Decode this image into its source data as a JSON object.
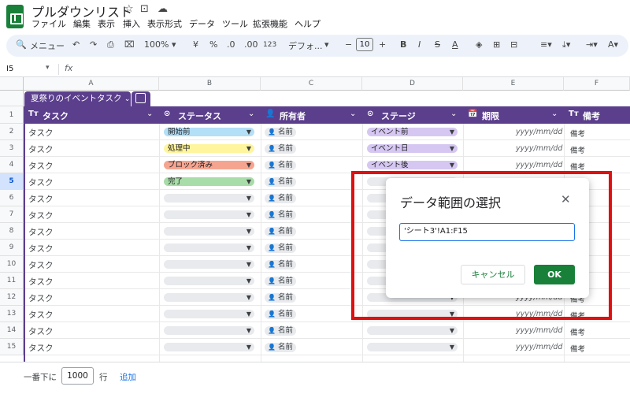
{
  "header": {
    "title": "プルダウンリスト",
    "menus": [
      "ファイル",
      "編集",
      "表示",
      "挿入",
      "表示形式",
      "データ",
      "ツール",
      "拡張機能",
      "ヘルプ"
    ]
  },
  "toolbar": {
    "search": "メニュー",
    "zoom": "100%",
    "currency": "¥",
    "percent": "%",
    "dec_less": ".0",
    "dec_more": ".00",
    "number_fmt": "123",
    "font": "デフォ...",
    "font_size": "10",
    "bold": "B",
    "italic": "I",
    "strike": "S",
    "text_color": "A"
  },
  "formula_bar": {
    "cell_ref": "I5",
    "fx": "fx"
  },
  "columns": [
    "A",
    "B",
    "C",
    "D",
    "E",
    "F"
  ],
  "table": {
    "name": "夏祭りのイベントタスク",
    "headers": [
      "タスク",
      "ステータス",
      "所有者",
      "ステージ",
      "期限",
      "備考"
    ],
    "header_icons": [
      "Tт",
      "⊙",
      "👤",
      "⊙",
      "📅",
      "Tт"
    ]
  },
  "rows": [
    {
      "num": "1"
    },
    {
      "num": "2",
      "task": "タスク",
      "status": "開始前",
      "status_color": "#b3dff7",
      "owner": "名前",
      "stage": "イベント前",
      "stage_color": "#d5c7f1",
      "date": "yyyy/mm/dd",
      "note": "備考"
    },
    {
      "num": "3",
      "task": "タスク",
      "status": "処理中",
      "status_color": "#fff59d",
      "owner": "名前",
      "stage": "イベント日",
      "stage_color": "#d5c7f1",
      "date": "yyyy/mm/dd",
      "note": "備考"
    },
    {
      "num": "4",
      "task": "タスク",
      "status": "ブロック済み",
      "status_color": "#f5a48f",
      "owner": "名前",
      "stage": "イベント後",
      "stage_color": "#d5c7f1",
      "date": "yyyy/mm/dd",
      "note": "備考"
    },
    {
      "num": "5",
      "task": "タスク",
      "status": "完了",
      "status_color": "#a8dca8",
      "owner": "名前",
      "stage": "",
      "stage_color": "#e8eaed",
      "date": "",
      "note": ""
    },
    {
      "num": "6",
      "task": "タスク",
      "status": "",
      "status_color": "#e8eaed",
      "owner": "名前",
      "stage": "",
      "stage_color": "#e8eaed",
      "date": "",
      "note": ""
    },
    {
      "num": "7",
      "task": "タスク",
      "status": "",
      "status_color": "#e8eaed",
      "owner": "名前",
      "stage": "",
      "stage_color": "#e8eaed",
      "date": "",
      "note": ""
    },
    {
      "num": "8",
      "task": "タスク",
      "status": "",
      "status_color": "#e8eaed",
      "owner": "名前",
      "stage": "",
      "stage_color": "#e8eaed",
      "date": "",
      "note": ""
    },
    {
      "num": "9",
      "task": "タスク",
      "status": "",
      "status_color": "#e8eaed",
      "owner": "名前",
      "stage": "",
      "stage_color": "#e8eaed",
      "date": "",
      "note": ""
    },
    {
      "num": "10",
      "task": "タスク",
      "status": "",
      "status_color": "#e8eaed",
      "owner": "名前",
      "stage": "",
      "stage_color": "#e8eaed",
      "date": "",
      "note": ""
    },
    {
      "num": "11",
      "task": "タスク",
      "status": "",
      "status_color": "#e8eaed",
      "owner": "名前",
      "stage": "",
      "stage_color": "#e8eaed",
      "date": "",
      "note": ""
    },
    {
      "num": "12",
      "task": "タスク",
      "status": "",
      "status_color": "#e8eaed",
      "owner": "名前",
      "stage": "",
      "stage_color": "#e8eaed",
      "date": "yyyy/mm/dd",
      "note": "備考"
    },
    {
      "num": "13",
      "task": "タスク",
      "status": "",
      "status_color": "#e8eaed",
      "owner": "名前",
      "stage": "",
      "stage_color": "#e8eaed",
      "date": "yyyy/mm/dd",
      "note": "備考"
    },
    {
      "num": "14",
      "task": "タスク",
      "status": "",
      "status_color": "#e8eaed",
      "owner": "名前",
      "stage": "",
      "stage_color": "#e8eaed",
      "date": "yyyy/mm/dd",
      "note": "備考"
    },
    {
      "num": "15",
      "task": "タスク",
      "status": "",
      "status_color": "#e8eaed",
      "owner": "名前",
      "stage": "",
      "stage_color": "#e8eaed",
      "date": "yyyy/mm/dd",
      "note": "備考"
    }
  ],
  "footer": {
    "prefix": "一番下に",
    "count": "1000",
    "unit": "行",
    "add": "追加"
  },
  "dialog": {
    "title": "データ範囲の選択",
    "range_value": "'シート3'!A1:F15",
    "cancel": "キャンセル",
    "ok": "OK"
  },
  "colors": {
    "accent": "#5b3f8c",
    "ok_button": "#188038",
    "highlight_border": "#e01010"
  }
}
